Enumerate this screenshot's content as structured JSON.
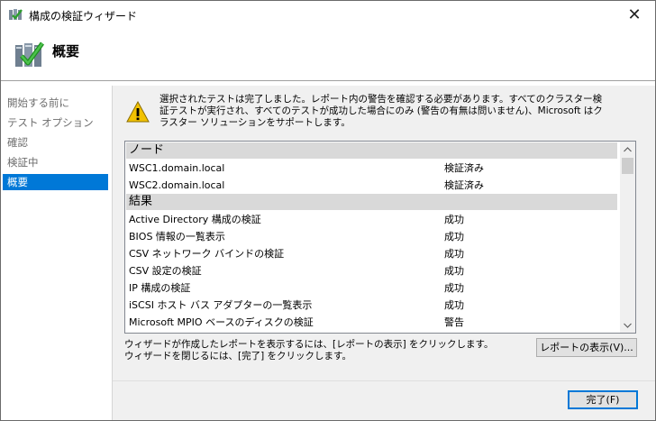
{
  "window": {
    "title": "構成の検証ウィザード",
    "close_glyph": "✕"
  },
  "header": {
    "title": "概要",
    "icon": "cluster-check-icon"
  },
  "sidebar": {
    "items": [
      {
        "label": "開始する前に"
      },
      {
        "label": "テスト オプション"
      },
      {
        "label": "確認"
      },
      {
        "label": "検証中"
      },
      {
        "label": "概要"
      }
    ],
    "active_index": 4
  },
  "summary": {
    "warning_icon": "warning-icon",
    "message": "選択されたテストは完了しました。レポート内の警告を確認する必要があります。すべてのクラスター検証テストが実行され、すべてのテストが成功した場合にのみ (警告の有無は問いません)、Microsoft はクラスター ソリューションをサポートします。"
  },
  "report": {
    "groups": [
      {
        "header": "ノード",
        "rows": [
          {
            "name": "WSC1.domain.local",
            "status": "検証済み"
          },
          {
            "name": "WSC2.domain.local",
            "status": "検証済み"
          }
        ]
      },
      {
        "header": "結果",
        "rows": [
          {
            "name": "Active Directory 構成の検証",
            "status": "成功"
          },
          {
            "name": "BIOS 情報の一覧表示",
            "status": "成功"
          },
          {
            "name": "CSV ネットワーク バインドの検証",
            "status": "成功"
          },
          {
            "name": "CSV 設定の検証",
            "status": "成功"
          },
          {
            "name": "IP 構成の検証",
            "status": "成功"
          },
          {
            "name": "iSCSI ホスト バス アダプターの一覧表示",
            "status": "成功"
          },
          {
            "name": "Microsoft MPIO ベースのディスクの検証",
            "status": "警告"
          }
        ]
      }
    ]
  },
  "info": {
    "line1": "ウィザードが作成したレポートを表示するには、[レポートの表示] をクリックします。",
    "line2": "ウィザードを閉じるには、[完了] をクリックします。"
  },
  "buttons": {
    "view_report": "レポートの表示(V)...",
    "finish": "完了(F)"
  },
  "colors": {
    "accent": "#0078d7",
    "warning": "#f2c200"
  }
}
